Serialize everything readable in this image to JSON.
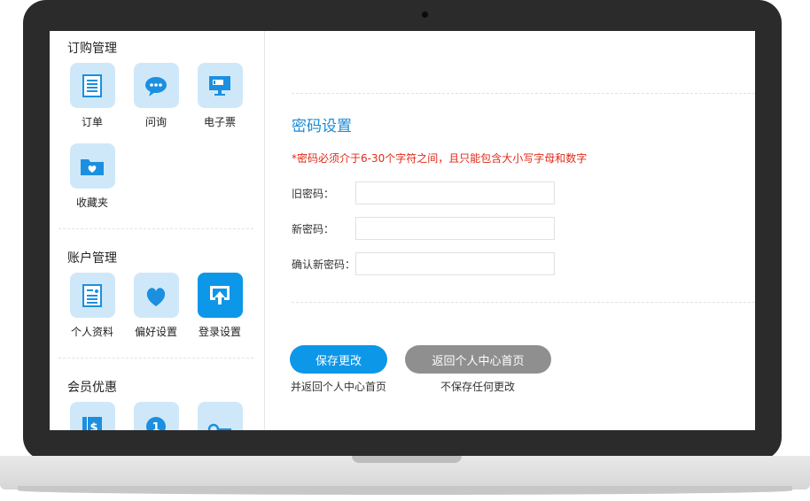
{
  "sidebar": {
    "sections": [
      {
        "title": "订购管理",
        "items": [
          {
            "label": "订单",
            "icon": "document-icon"
          },
          {
            "label": "问询",
            "icon": "chat-bubble-icon"
          },
          {
            "label": "电子票",
            "icon": "monitor-ticket-icon"
          },
          {
            "label": "收藏夹",
            "icon": "favorite-folder-icon"
          }
        ]
      },
      {
        "title": "账户管理",
        "items": [
          {
            "label": "个人资料",
            "icon": "profile-card-icon"
          },
          {
            "label": "偏好设置",
            "icon": "heart-icon"
          },
          {
            "label": "登录设置",
            "icon": "login-upload-icon"
          }
        ]
      },
      {
        "title": "会员优惠",
        "items": [
          {
            "label": "",
            "icon": "coupon-dollar-icon"
          },
          {
            "label": "",
            "icon": "info-circle-icon"
          },
          {
            "label": "",
            "icon": "key-icon"
          }
        ]
      }
    ]
  },
  "main": {
    "title": "密码设置",
    "notice": "*密码必须介于6-30个字符之间，且只能包含大小写字母和数字",
    "fields": {
      "old_password_label": "旧密码：",
      "new_password_label": "新密码：",
      "confirm_password_label": "确认新密码："
    },
    "buttons": {
      "save_label": "保存更改",
      "save_caption": "并返回个人中心首页",
      "back_label": "返回个人中心首页",
      "back_caption": "不保存任何更改"
    }
  },
  "colors": {
    "accent": "#0d97e8",
    "tile_bg": "#cfe8f9",
    "notice_red": "#e02a17",
    "title_blue": "#1a8ad6",
    "secondary_button": "#8f8f8f",
    "frame": "#2b2b2b"
  }
}
